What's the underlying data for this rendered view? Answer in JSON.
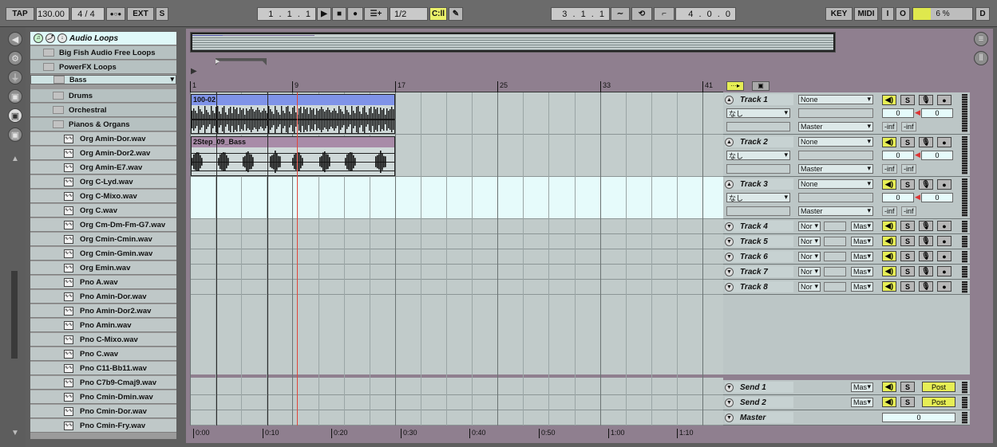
{
  "transport": {
    "tap": "TAP",
    "tempo": "130.00",
    "signature": "4 / 4",
    "metro": "●○●",
    "ext": "EXT",
    "s": "S",
    "position": "1 .  1 .  1",
    "quantize": "1/2",
    "loop_start": "3 .  1 .  1",
    "loop_length": "4 .  0 .  0",
    "key": "KEY",
    "midi": "MIDI",
    "i": "I",
    "o": "O",
    "cpu": "6 %",
    "d": "D"
  },
  "browser": {
    "header": "Audio Loops",
    "items": [
      {
        "type": "folder",
        "label": "Big Fish Audio Free Loops",
        "indent": 1
      },
      {
        "type": "folder",
        "label": "PowerFX Loops",
        "indent": 1
      },
      {
        "type": "folder",
        "label": "Bass",
        "indent": 2,
        "selected": true
      },
      {
        "type": "folder",
        "label": "Drums",
        "indent": 2
      },
      {
        "type": "folder",
        "label": "Orchestral",
        "indent": 2
      },
      {
        "type": "folder",
        "label": "Pianos & Organs",
        "indent": 2
      },
      {
        "type": "file",
        "label": "Org Amin-Dor.wav"
      },
      {
        "type": "file",
        "label": "Org Amin-Dor2.wav"
      },
      {
        "type": "file",
        "label": "Org Amin-E7.wav"
      },
      {
        "type": "file",
        "label": "Org C-Lyd.wav"
      },
      {
        "type": "file",
        "label": "Org C-Mixo.wav"
      },
      {
        "type": "file",
        "label": "Org C.wav"
      },
      {
        "type": "file",
        "label": "Org Cm-Dm-Fm-G7.wav"
      },
      {
        "type": "file",
        "label": "Org Cmin-Cmin.wav"
      },
      {
        "type": "file",
        "label": "Org Cmin-Gmin.wav"
      },
      {
        "type": "file",
        "label": "Org Emin.wav"
      },
      {
        "type": "file",
        "label": "Pno A.wav"
      },
      {
        "type": "file",
        "label": "Pno Amin-Dor.wav"
      },
      {
        "type": "file",
        "label": "Pno Amin-Dor2.wav"
      },
      {
        "type": "file",
        "label": "Pno Amin.wav"
      },
      {
        "type": "file",
        "label": "Pno C-Mixo.wav"
      },
      {
        "type": "file",
        "label": "Pno C.wav"
      },
      {
        "type": "file",
        "label": "Pno C11-Bb11.wav"
      },
      {
        "type": "file",
        "label": "Pno C7b9-Cmaj9.wav"
      },
      {
        "type": "file",
        "label": "Pno Cmin-Dmin.wav"
      },
      {
        "type": "file",
        "label": "Pno Cmin-Dor.wav"
      },
      {
        "type": "file",
        "label": "Pno Cmin-Fry.wav"
      }
    ]
  },
  "ruler": {
    "bars": [
      "1",
      "9",
      "17",
      "25",
      "33",
      "41"
    ],
    "times": [
      "0:00",
      "0:10",
      "0:20",
      "0:30",
      "0:40",
      "0:50",
      "1:00",
      "1:10"
    ]
  },
  "clips": {
    "clip1": "100-02",
    "clip2": "2Step_09_Bass"
  },
  "tracks": {
    "t1": {
      "name": "Track 1",
      "input": "None",
      "sub": "なし",
      "out": "Master",
      "vol": "0",
      "pan": "0",
      "inf1": "-inf",
      "inf2": "-inf"
    },
    "t2": {
      "name": "Track 2",
      "input": "None",
      "sub": "なし",
      "out": "Master",
      "vol": "0",
      "pan": "0",
      "inf1": "-inf",
      "inf2": "-inf"
    },
    "t3": {
      "name": "Track 3",
      "input": "None",
      "sub": "なし",
      "out": "Master",
      "vol": "0",
      "pan": "0",
      "inf1": "-inf",
      "inf2": "-inf"
    },
    "t4": {
      "name": "Track 4",
      "input": "Nor",
      "out": "Mas"
    },
    "t5": {
      "name": "Track 5",
      "input": "Nor",
      "out": "Mas"
    },
    "t6": {
      "name": "Track 6",
      "input": "Nor",
      "out": "Mas"
    },
    "t7": {
      "name": "Track 7",
      "input": "Nor",
      "out": "Mas"
    },
    "t8": {
      "name": "Track 8",
      "input": "Nor",
      "out": "Mas"
    }
  },
  "returns": {
    "send1": {
      "name": "Send 1",
      "out": "Mas",
      "post": "Post"
    },
    "send2": {
      "name": "Send 2",
      "out": "Mas",
      "post": "Post"
    },
    "master": {
      "name": "Master",
      "vol": "0"
    }
  },
  "buttons": {
    "solo": "S"
  }
}
